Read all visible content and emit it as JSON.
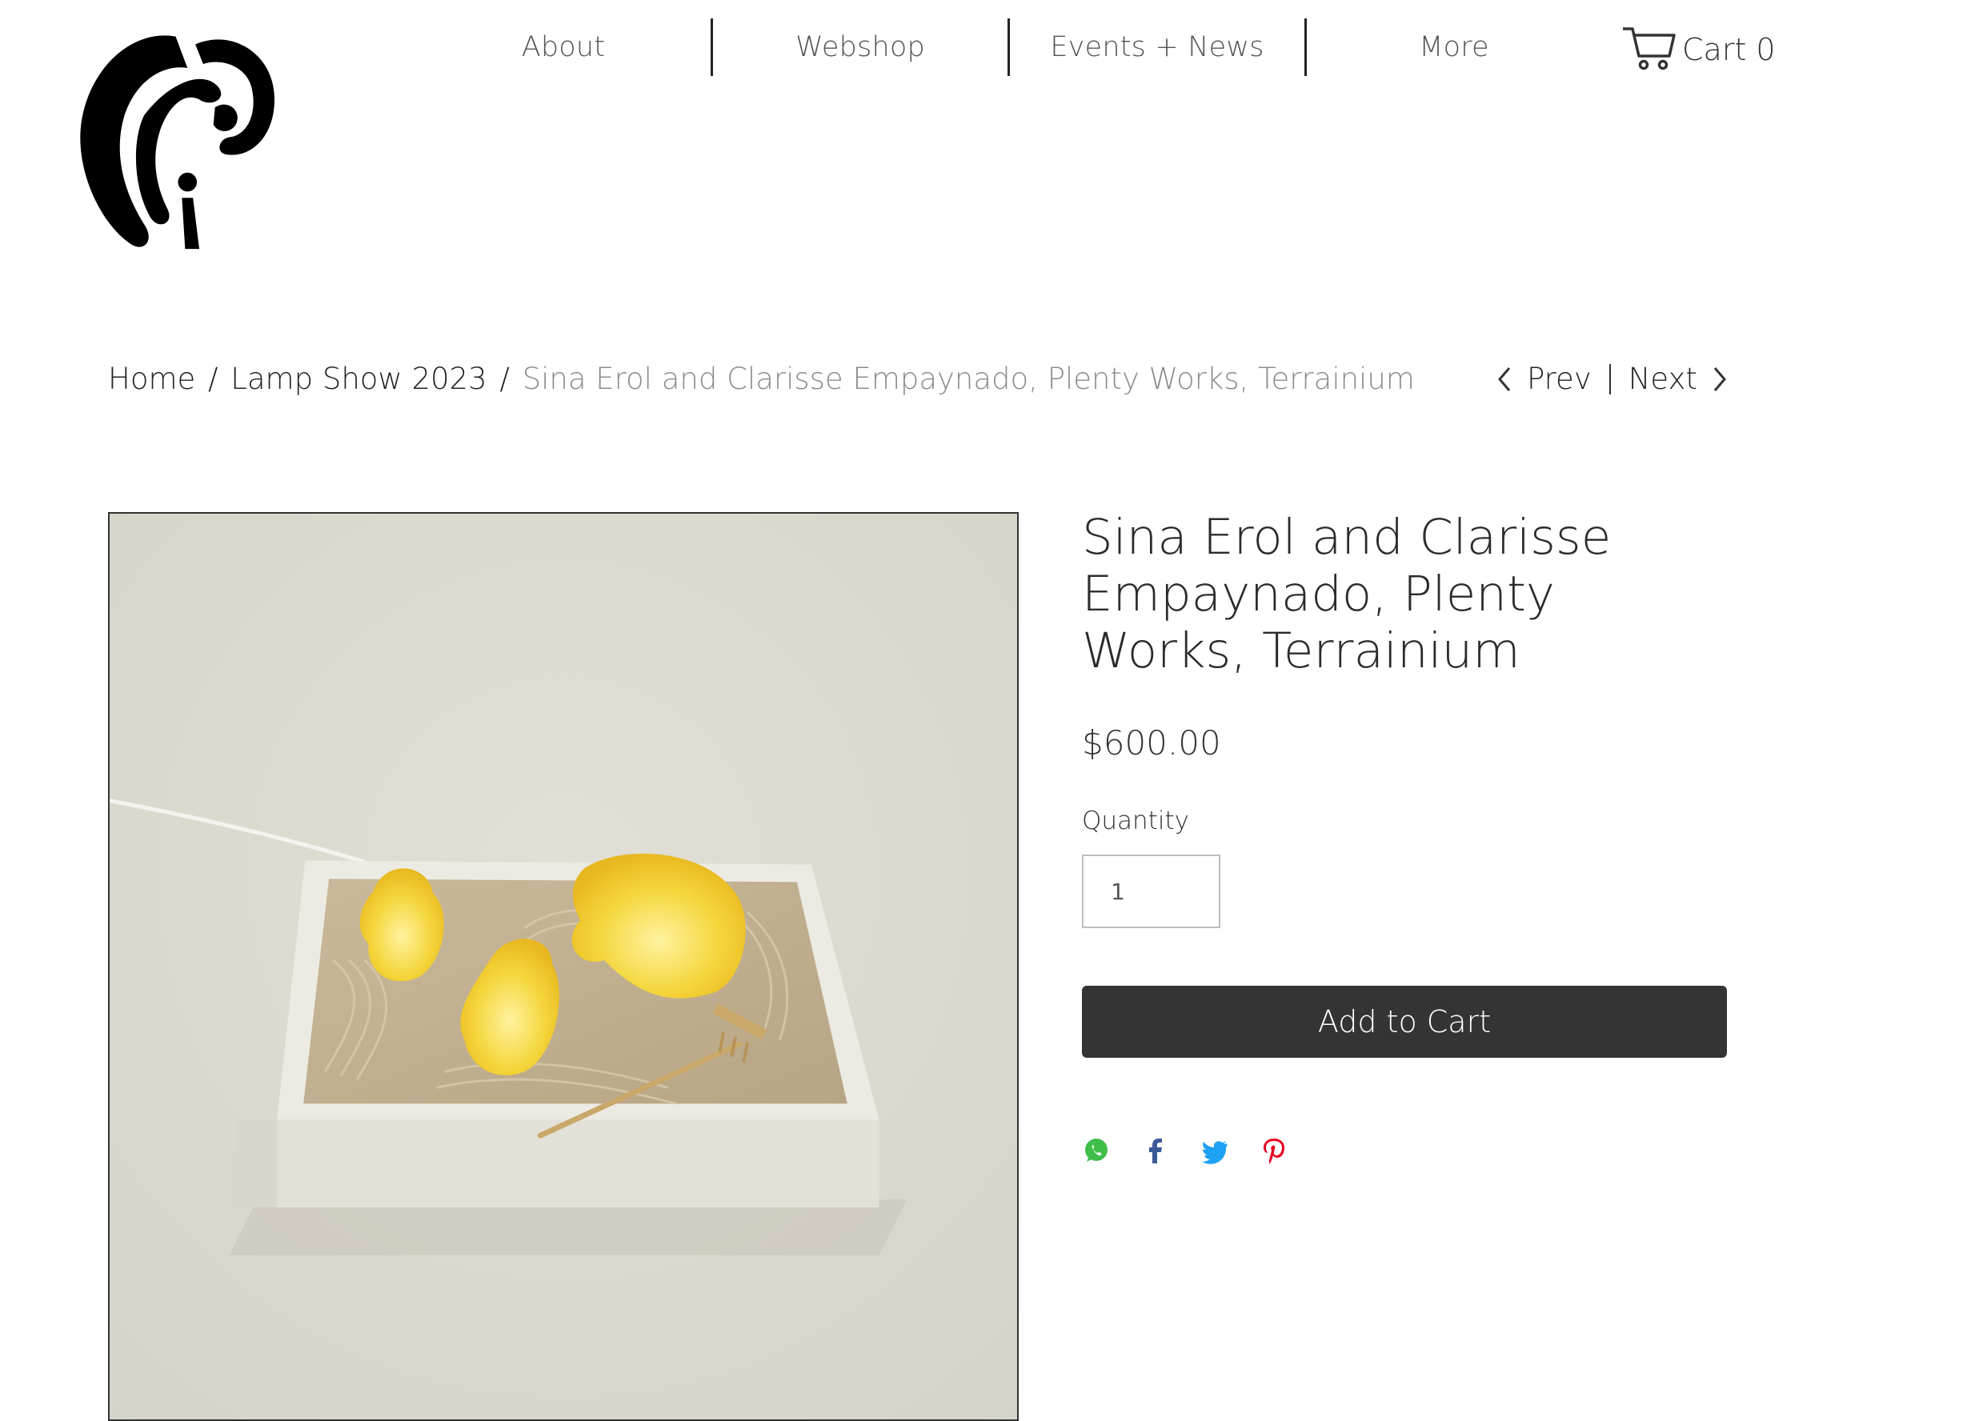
{
  "nav": {
    "items": [
      {
        "label": "About"
      },
      {
        "label": "Webshop"
      },
      {
        "label": "Events + News"
      },
      {
        "label": "More"
      }
    ],
    "cart_label": "Cart 0"
  },
  "breadcrumb": {
    "home": "Home",
    "sep1": "/",
    "category": "Lamp Show 2023",
    "sep2": "/",
    "current": "Sina Erol and Clarisse Empaynado, Plenty Works, Terrainium"
  },
  "pager": {
    "prev": "Prev",
    "next": "Next"
  },
  "product": {
    "title": "Sina Erol and Clarisse Empaynado, Plenty Works, Terrainium",
    "price": "$600.00",
    "quantity_label": "Quantity",
    "quantity_value": "1",
    "add_to_cart": "Add to Cart"
  },
  "share": {
    "icons": [
      "whatsapp-icon",
      "facebook-icon",
      "twitter-icon",
      "pinterest-icon"
    ],
    "colors": {
      "whatsapp": "#3fbf4a",
      "facebook": "#3b5998",
      "twitter": "#1da1f2",
      "pinterest": "#e60023"
    }
  },
  "colors": {
    "button_bg": "#343434",
    "text": "#2b2b2b",
    "breadcrumb_current": "#8c8c8c"
  }
}
